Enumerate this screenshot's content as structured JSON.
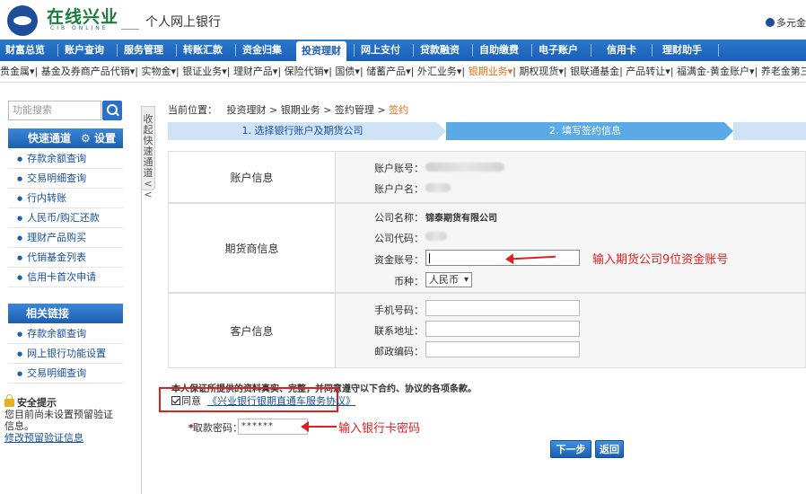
{
  "header": {
    "logo_cn": "在线兴业",
    "logo_en": "CIB ONLINE",
    "bank_title": "个人网上银行",
    "top_right": "多元金"
  },
  "nav": {
    "items": [
      "财富总览",
      "账户查询",
      "服务管理",
      "转账汇款",
      "资金归集",
      "投资理财",
      "网上支付",
      "贷款融资",
      "自助缴费",
      "电子账户",
      "信用卡",
      "理财助手"
    ],
    "active_index": 5
  },
  "subnav": {
    "items": [
      "贵金属▾",
      "基金及券商产品代销▾",
      "实物金▾",
      "银证业务▾",
      "理财产品▾",
      "保险代销▾",
      "国债▾",
      "储蓄产品▾",
      "外汇业务▾",
      "银期业务▾",
      "期权现货▾",
      "银联通基金",
      "产品转让▾",
      "福满金-黄金账户▾",
      "养老金第三支"
    ],
    "highlight_index": 9
  },
  "sidebar": {
    "search_placeholder": "功能搜索",
    "quick_title": "快速通道",
    "settings_label": "设置",
    "quick_items": [
      "存款余额查询",
      "交易明细查询",
      "行内转账",
      "人民币/购汇还款",
      "理财产品购买",
      "代销基金列表",
      "信用卡首次申请"
    ],
    "links_title": "相关链接",
    "link_items": [
      "存款余额查询",
      "网上银行功能设置",
      "交易明细查询"
    ],
    "safety_title": "安全提示",
    "safety_text": "您目前尚未设置预留验证信息。",
    "safety_link": "修改预留验证信息"
  },
  "collapse_label": "收起快速通道<<",
  "breadcrumb": {
    "prefix": "当前位置：",
    "path": "投资理财 > 银期业务 > 签约管理 > ",
    "current": "签约"
  },
  "steps": {
    "step1": "1. 选择银行账户及期货公司",
    "step2": "2. 填写签约信息"
  },
  "sections": {
    "account": {
      "label": "账户信息",
      "account_no_label": "账户账号：",
      "account_name_label": "账户户名："
    },
    "futures": {
      "label": "期货商信息",
      "company_name_label": "公司名称：",
      "company_name": "锦泰期货有限公司",
      "company_code_label": "公司代码：",
      "fund_account_label": "资金账号：",
      "fund_account_value": "",
      "currency_label": "币种：",
      "currency_value": "人民币"
    },
    "customer": {
      "label": "客户信息",
      "phone_label": "手机号码：",
      "address_label": "联系地址：",
      "zip_label": "邮政编码：",
      "phone_value": "",
      "address_value": "",
      "zip_value": ""
    }
  },
  "agreement": {
    "statement": "本人保证所提供的资料真实、完整，并同意遵守以下合约、协议的各项条款。",
    "agree_label": "同意",
    "link_text": "《兴业银行银期直通车服务协议》"
  },
  "password": {
    "label": "*取款密码：",
    "value": "******"
  },
  "annotations": {
    "fund_hint": "输入期货公司9位资金账号",
    "pwd_hint": "输入银行卡密码"
  },
  "buttons": {
    "next": "下一步",
    "back": "返回"
  },
  "colors": {
    "nav_blue": "#1a5fb4",
    "annotation_red": "#e02020",
    "highlight_orange": "#e8701a"
  }
}
